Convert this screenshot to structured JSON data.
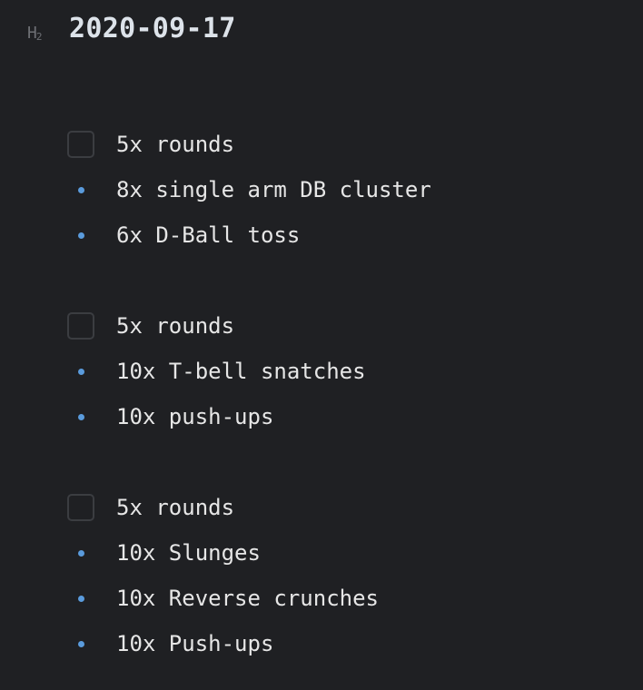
{
  "heading": {
    "level_marker": "H",
    "level_number": "2",
    "title": "2020-09-17"
  },
  "groups": [
    {
      "task": {
        "label": "5x rounds",
        "checked": false
      },
      "items": [
        "8x single arm DB cluster",
        "6x D-Ball toss"
      ]
    },
    {
      "task": {
        "label": "5x rounds",
        "checked": false
      },
      "items": [
        "10x T-bell snatches",
        "10x push-ups"
      ]
    },
    {
      "task": {
        "label": "5x rounds",
        "checked": false
      },
      "items": [
        "10x Slunges",
        "10x Reverse crunches",
        "10x Push-ups"
      ]
    }
  ],
  "colors": {
    "background": "#1f2023",
    "bullet": "#5a9bdc",
    "checkbox_border": "#3b3d41"
  }
}
